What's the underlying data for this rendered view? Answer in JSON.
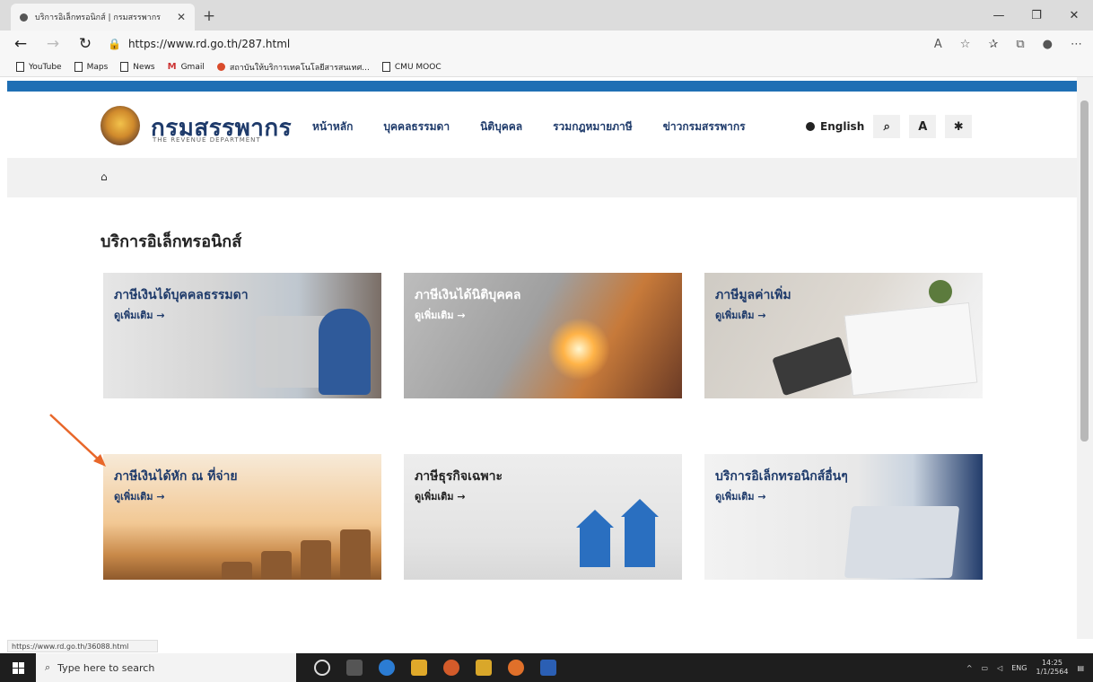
{
  "browser": {
    "tab_title": "บริการอิเล็กทรอนิกส์ | กรมสรรพากร",
    "address": "https://www.rd.go.th/287.html",
    "bookmarks": [
      "YouTube",
      "Maps",
      "News",
      "Gmail",
      "สถาบันให้บริการเทคโนโลยีสารสนเทศ...",
      "CMU MOOC"
    ],
    "status_url": "https://www.rd.go.th/36088.html"
  },
  "site": {
    "brand": "กรมสรรพากร",
    "brand_sub": "THE REVENUE DEPARTMENT",
    "menu": [
      "หน้าหลัก",
      "บุคคลธรรมดา",
      "นิติบุคคล",
      "รวมกฎหมายภาษี",
      "ข่าวกรมสรรพากร"
    ],
    "english": "English",
    "font_btn": "A",
    "page_title": "บริการอิเล็กทรอนิกส์",
    "more_label": "ดูเพิ่มเติม →",
    "cards": [
      {
        "title": "ภาษีเงินได้บุคคลธรรมดา"
      },
      {
        "title": "ภาษีเงินได้นิติบุคคล"
      },
      {
        "title": "ภาษีมูลค่าเพิ่ม"
      },
      {
        "title": "ภาษีเงินได้หัก ณ ที่จ่าย"
      },
      {
        "title": "ภาษีธุรกิจเฉพาะ"
      },
      {
        "title": "บริการอิเล็กทรอนิกส์อื่นๆ"
      }
    ]
  },
  "taskbar": {
    "search_placeholder": "Type here to search",
    "lang": "ENG",
    "time": "14:25",
    "date": "1/1/2564"
  },
  "colors": {
    "brand_blue": "#1f6fb4",
    "nav_blue": "#1f3b6b",
    "pointer_arrow": "#e8672a"
  }
}
